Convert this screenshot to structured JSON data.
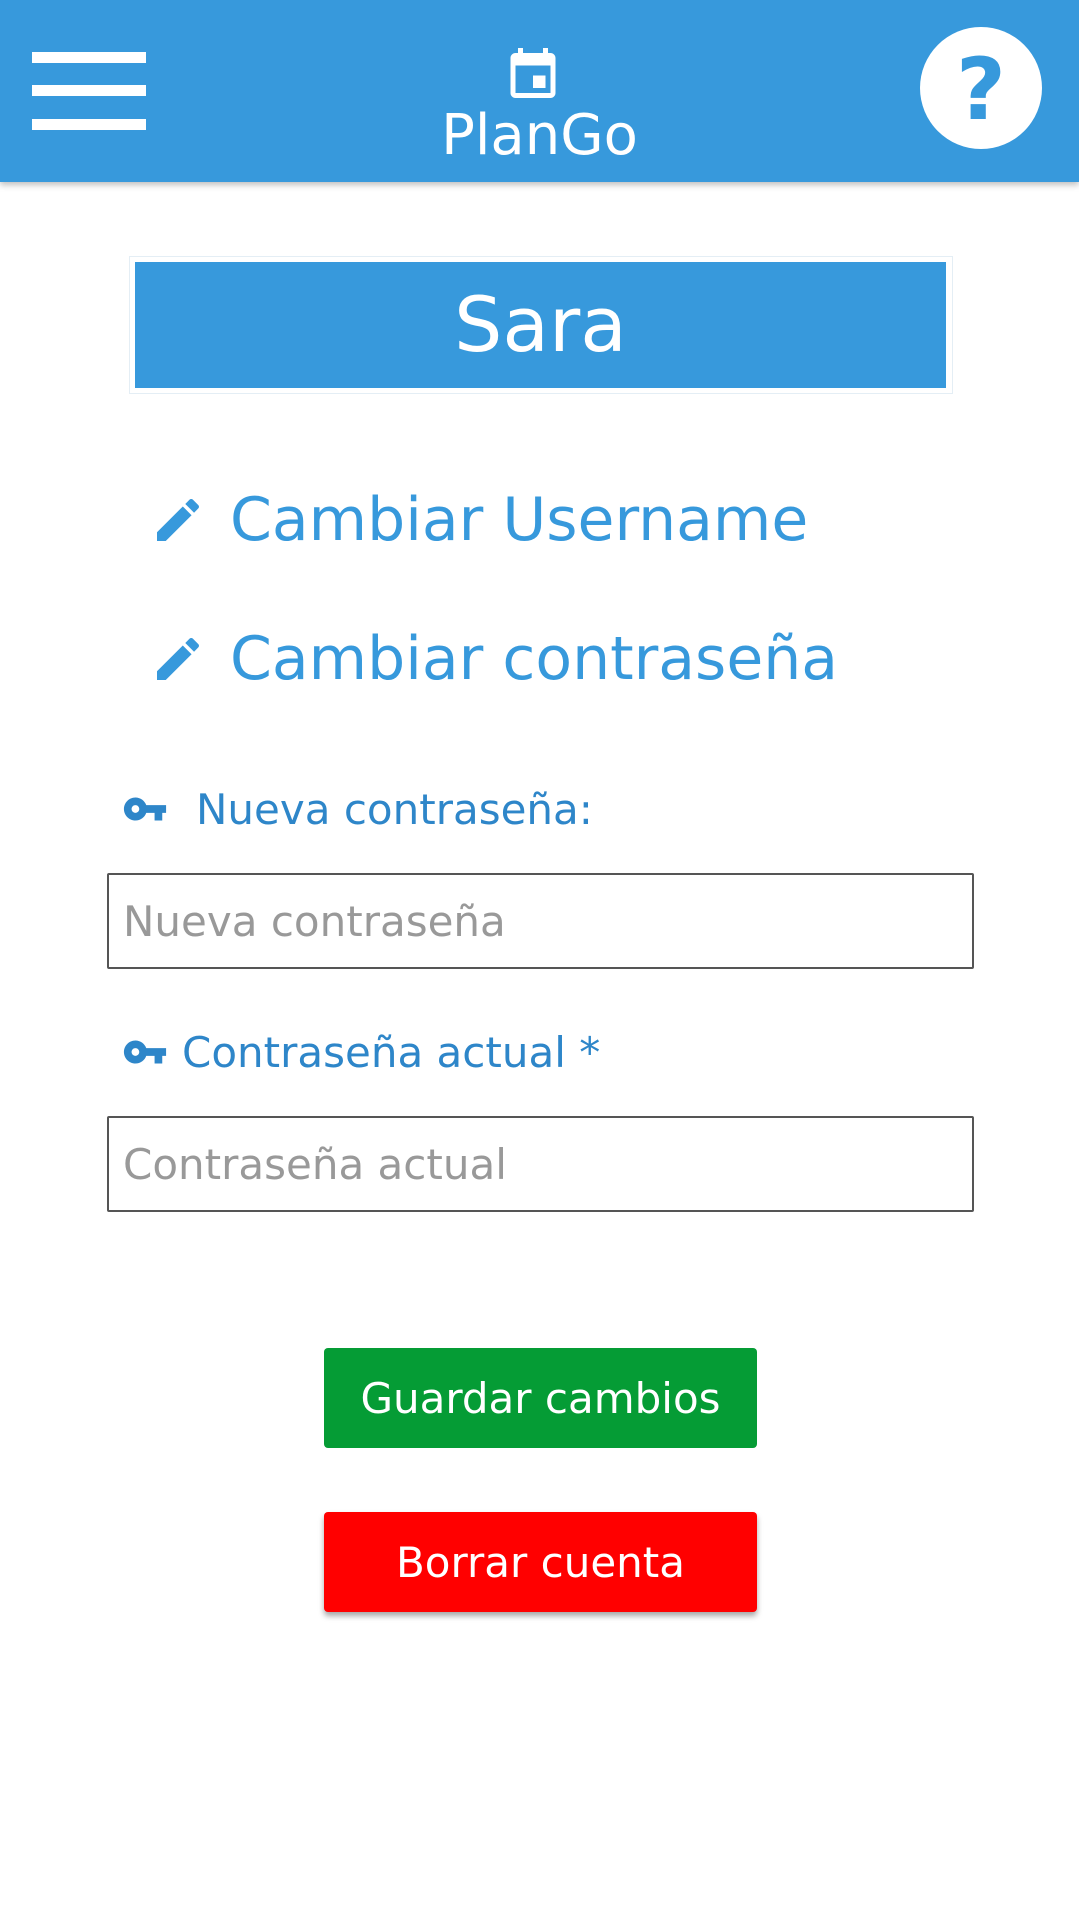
{
  "header": {
    "app_title": "PlanGo",
    "menu_icon": "hamburger-menu-icon",
    "brand_icon": "calendar-icon",
    "help_icon": "question-mark-icon"
  },
  "user": {
    "name": "Sara"
  },
  "actions": {
    "change_username": "Cambiar Username",
    "change_password": "Cambiar contraseña",
    "icon": "pencil-icon"
  },
  "form": {
    "new_password": {
      "label": "Nueva contraseña:",
      "placeholder": "Nueva contraseña",
      "value": "",
      "icon": "key-icon"
    },
    "current_password": {
      "label": "Contraseña actual *",
      "placeholder": "Contraseña actual",
      "value": "",
      "icon": "key-icon"
    }
  },
  "buttons": {
    "save": "Guardar cambios",
    "delete": "Borrar cuenta"
  },
  "colors": {
    "primary": "#3799dc",
    "save": "#059c35",
    "delete": "#ff0000",
    "label": "#2e86c9"
  }
}
